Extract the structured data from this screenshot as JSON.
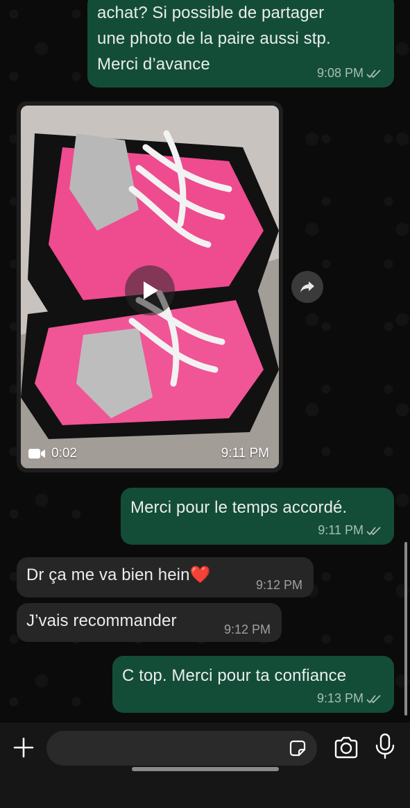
{
  "messages": [
    {
      "id": "m1",
      "direction": "outgoing",
      "lines": [
        "achat? Si possible de partager",
        "une photo de la paire aussi stp.",
        "Merci d’avance"
      ],
      "time": "9:08 PM",
      "status": "read"
    },
    {
      "id": "m2",
      "direction": "incoming",
      "type": "video",
      "duration": "0:02",
      "time": "9:11 PM",
      "description_icon": "video-camera-icon"
    },
    {
      "id": "m3",
      "direction": "outgoing",
      "text": "Merci pour le temps accordé.",
      "time": "9:11 PM",
      "status": "read"
    },
    {
      "id": "m4",
      "direction": "incoming",
      "text": "Dr ça me va bien hein",
      "emoji": "❤️",
      "time": "9:12 PM"
    },
    {
      "id": "m5",
      "direction": "incoming",
      "text": "J’vais recommander",
      "time": "9:12 PM"
    },
    {
      "id": "m6",
      "direction": "outgoing",
      "text": "C top. Merci pour ta confiance",
      "time": "9:13 PM",
      "status": "read"
    }
  ],
  "composer": {
    "placeholder": "",
    "icons": [
      "plus-icon",
      "sticker-icon",
      "camera-icon",
      "microphone-icon"
    ]
  },
  "colors": {
    "outgoing_bubble": "#144d37",
    "incoming_bubble": "#262626",
    "background": "#0b0b0b",
    "read_ticks": "#a6c0b2"
  }
}
